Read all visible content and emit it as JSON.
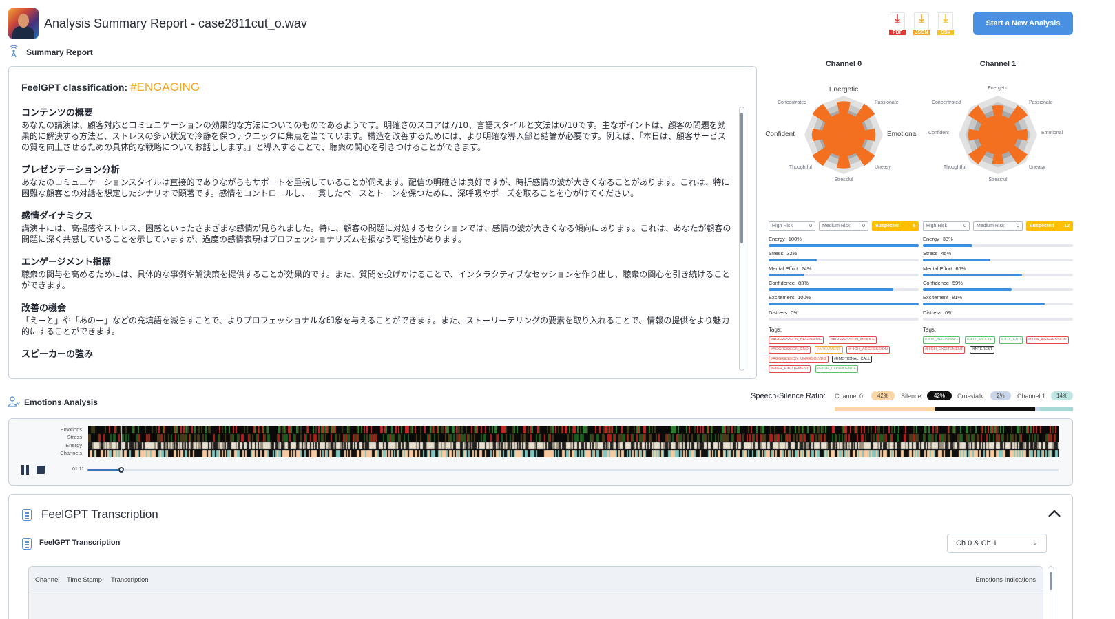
{
  "header": {
    "title": "Analysis Summary Report - case2811cut_o.wav",
    "downloads": [
      {
        "label": "PDF",
        "color": "#e53935",
        "icon": "pdf-download-icon"
      },
      {
        "label": "JSON",
        "color": "#f5a623",
        "icon": "json-download-icon"
      },
      {
        "label": "CSV",
        "color": "#f7c325",
        "icon": "csv-download-icon"
      }
    ],
    "new_analysis_button": "Start a New Analysis"
  },
  "summary": {
    "section_label": "Summary Report",
    "classification_label": "FeelGPT classification:",
    "classification_value": "#ENGAGING",
    "sections": [
      {
        "heading": "コンテンツの概要",
        "text": "あなたの講演は、顧客対応とコミュニケーションの効果的な方法についてのものであるようです。明確さのスコアは7/10、言語スタイルと文法は6/10です。主なポイントは、顧客の問題を効果的に解決する方法と、ストレスの多い状況で冷静を保つテクニックに焦点を当てています。構造を改善するためには、より明確な導入部と結論が必要です。例えば、「本日は、顧客サービスの質を向上させるための具体的な戦略についてお話しします。」と導入することで、聴衆の関心を引きつけることができます。"
      },
      {
        "heading": "プレゼンテーション分析",
        "text": "あなたのコミュニケーションスタイルは直接的でありながらもサポートを重視していることが伺えます。配信の明確さは良好ですが、時折感情の波が大きくなることがあります。これは、特に困難な顧客との対話を想定したシナリオで顕著です。感情をコントロールし、一貫したペースとトーンを保つために、深呼吸やポーズを取ることを心がけてください。"
      },
      {
        "heading": "感情ダイナミクス",
        "text": "講演中には、高揚感やストレス、困惑といったさまざまな感情が見られました。特に、顧客の問題に対処するセクションでは、感情の波が大きくなる傾向にあります。これは、あなたが顧客の問題に深く共感していることを示していますが、過度の感情表現はプロフェッショナリズムを損なう可能性があります。"
      },
      {
        "heading": "エンゲージメント指標",
        "text": "聴衆の関与を高めるためには、具体的な事例や解決策を提供することが効果的です。また、質問を投げかけることで、インタラクティブなセッションを作り出し、聴衆の関心を引き続けることができます。"
      },
      {
        "heading": "改善の機会",
        "text": "「えーと」や「あのー」などの充填語を減らすことで、よりプロフェッショナルな印象を与えることができます。また、ストーリーテリングの要素を取り入れることで、情報の提供をより魅力的にすることができます。"
      },
      {
        "heading": "スピーカーの強み",
        "text": ""
      }
    ]
  },
  "channels": [
    {
      "title": "Channel 0",
      "radar_labels": {
        "top": "Energetic",
        "top_left": "Concentrated",
        "top_right": "Passionate",
        "left": "Confident",
        "right": "Emotional",
        "bottom_left": "Thoughtful",
        "bottom_right": "Uneasy",
        "bottom": "Stressful"
      },
      "radar_values": [
        0.85,
        0.55,
        0.95,
        0.55,
        0.8,
        0.55,
        0.95,
        0.55,
        0.85,
        0.55,
        0.95,
        0.55,
        0.8,
        0.55,
        0.95,
        0.55
      ],
      "risk": {
        "high": "High Risk",
        "high_count": "0",
        "medium": "Medium Risk",
        "medium_count": "0",
        "suspected": "Suspected",
        "suspected_count": "5"
      },
      "metrics": [
        {
          "label": "Energy",
          "value": "100%",
          "fraction": 1.0
        },
        {
          "label": "Stress",
          "value": "32%",
          "fraction": 0.32
        },
        {
          "label": "Mental Effort",
          "value": "24%",
          "fraction": 0.24
        },
        {
          "label": "Confidence",
          "value": "83%",
          "fraction": 0.83
        },
        {
          "label": "Excitement",
          "value": "100%",
          "fraction": 1.0
        },
        {
          "label": "Distress",
          "value": "0%",
          "fraction": 0.0
        }
      ],
      "tags_label": "Tags:",
      "tags": [
        {
          "text": "#AGGRESSION_BEGINNING",
          "color": "red"
        },
        {
          "text": "#AGGRESSION_MIDDLE",
          "color": "red"
        },
        {
          "text": "#AGGRESSION_END",
          "color": "red"
        },
        {
          "text": "#ARGUMENT",
          "color": "orange"
        },
        {
          "text": "#HIGH_AGGRESSION",
          "color": "red"
        },
        {
          "text": "#AGGRESSION_UNRESOLVED",
          "color": "red"
        },
        {
          "text": "#EMOTIONAL_CALL",
          "color": "dark"
        },
        {
          "text": "#HIGH_EXCITEMENT",
          "color": "red"
        },
        {
          "text": "#HIGH_CONFIDENCE",
          "color": "green"
        }
      ]
    },
    {
      "title": "Channel 1",
      "radar_labels": {
        "top": "Energetic",
        "top_left": "Concentrated",
        "top_right": "Passionate",
        "left": "Confident",
        "right": "Emotional",
        "bottom_left": "Thoughtful",
        "bottom_right": "Uneasy",
        "bottom": "Stressful"
      },
      "radar_values": [
        0.75,
        0.5,
        0.9,
        0.5,
        0.75,
        0.5,
        0.9,
        0.5,
        0.75,
        0.5,
        0.9,
        0.5,
        0.75,
        0.5,
        0.9,
        0.5
      ],
      "risk": {
        "high": "High Risk",
        "high_count": "0",
        "medium": "Medium Risk",
        "medium_count": "0",
        "suspected": "Suspected",
        "suspected_count": "12"
      },
      "metrics": [
        {
          "label": "Energy",
          "value": "33%",
          "fraction": 0.33
        },
        {
          "label": "Stress",
          "value": "45%",
          "fraction": 0.45
        },
        {
          "label": "Mental Effort",
          "value": "66%",
          "fraction": 0.66
        },
        {
          "label": "Confidence",
          "value": "59%",
          "fraction": 0.59
        },
        {
          "label": "Excitement",
          "value": "81%",
          "fraction": 0.81
        },
        {
          "label": "Distress",
          "value": "0%",
          "fraction": 0.0
        }
      ],
      "tags_label": "Tags:",
      "tags": [
        {
          "text": "#JOY_BEGINNING",
          "color": "green"
        },
        {
          "text": "#JOY_MIDDLE",
          "color": "green"
        },
        {
          "text": "#JOY_END",
          "color": "green"
        },
        {
          "text": "#LOW_AGGRESSION",
          "color": "red"
        },
        {
          "text": "#HIGH_EXCITEMENT",
          "color": "red"
        },
        {
          "text": "#INTEREST",
          "color": "dark"
        }
      ]
    }
  ],
  "speech_silence": {
    "label": "Speech-Silence Ratio:",
    "items": [
      {
        "label": "Channel 0:",
        "value": "42%",
        "bg": "#fcd7a6",
        "fg": "#444"
      },
      {
        "label": "Silence:",
        "value": "42%",
        "bg": "#111111",
        "fg": "#ffffff"
      },
      {
        "label": "Crosstalk:",
        "value": "2%",
        "bg": "#c9d6ea",
        "fg": "#444"
      },
      {
        "label": "Channel 1:",
        "value": "14%",
        "bg": "#bfe6e3",
        "fg": "#444"
      }
    ],
    "bar_fractions": [
      0.42,
      0.42,
      0.02,
      0.14
    ],
    "bar_colors": [
      "#fcd7a6",
      "#111111",
      "#c9d6ea",
      "#a7d8d4"
    ]
  },
  "emotions": {
    "section_label": "Emotions Analysis",
    "row_labels": [
      "Emotions",
      "Stress",
      "Energy",
      "Channels"
    ],
    "time": "01:11",
    "progress": 0.035
  },
  "transcription": {
    "title": "FeelGPT Transcription",
    "subtitle": "FeelGPT Transcription",
    "channel_select": "Ch 0 & Ch 1",
    "columns": [
      "Channel",
      "Time Stamp",
      "Transcription"
    ],
    "right_column": "Emotions Indications"
  }
}
